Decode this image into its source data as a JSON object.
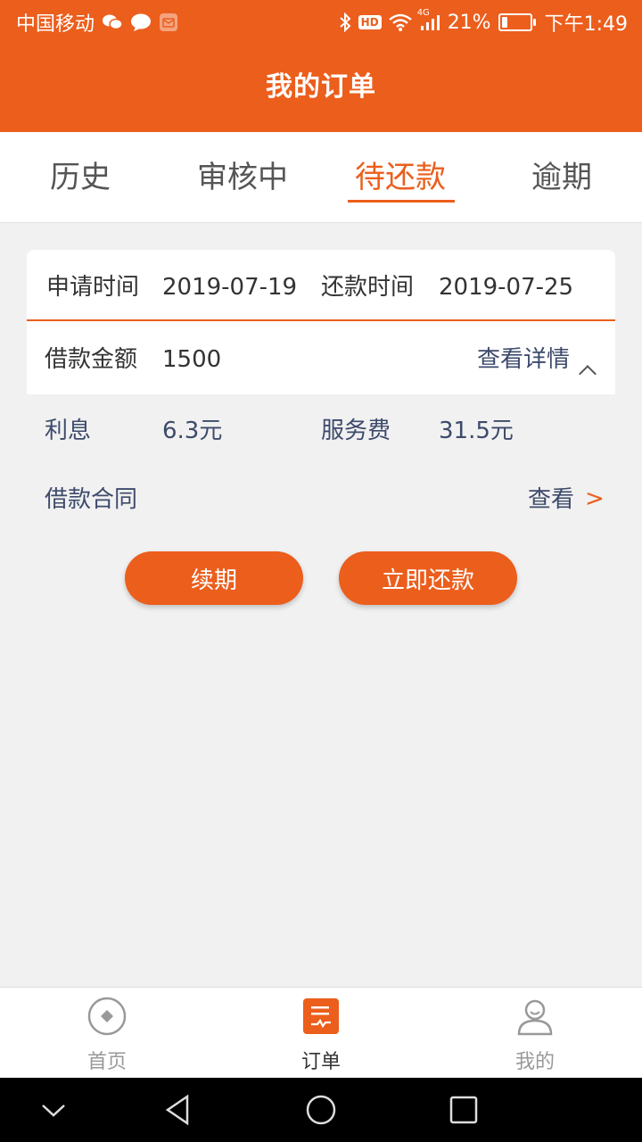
{
  "status_bar": {
    "carrier": "中国移动",
    "network": "4G",
    "battery": "21%",
    "time": "下午1:49",
    "icons": [
      "wechat-icon",
      "message-icon",
      "mail-icon",
      "bluetooth-icon",
      "hd-icon",
      "wifi-icon",
      "signal-icon",
      "battery-icon"
    ],
    "hd": "HD",
    "battery_level": 0.21
  },
  "header": {
    "title": "我的订单"
  },
  "tabs": [
    {
      "label": "历史"
    },
    {
      "label": "审核中"
    },
    {
      "label": "待还款",
      "active": true
    },
    {
      "label": "逾期"
    }
  ],
  "order": {
    "apply_label": "申请时间",
    "apply_date": "2019-07-19",
    "repay_label": "还款时间",
    "repay_date": "2019-07-25",
    "amount_label": "借款金额",
    "amount": "1500",
    "details_link": "查看详情",
    "interest_label": "利息",
    "interest": "6.3元",
    "fee_label": "服务费",
    "fee": "31.5元",
    "contract_label": "借款合同",
    "contract_link": "查看",
    "contract_arrow": ">"
  },
  "buttons": {
    "renew": "续期",
    "repay_now": "立即还款"
  },
  "bottom_nav": [
    {
      "label": "首页",
      "icon": "home-icon"
    },
    {
      "label": "订单",
      "icon": "orders-icon",
      "active": true
    },
    {
      "label": "我的",
      "icon": "profile-icon"
    }
  ],
  "colors": {
    "accent": "#ec5e1c",
    "background": "#f1f1f1",
    "secondary_text": "#3d4a6b"
  }
}
